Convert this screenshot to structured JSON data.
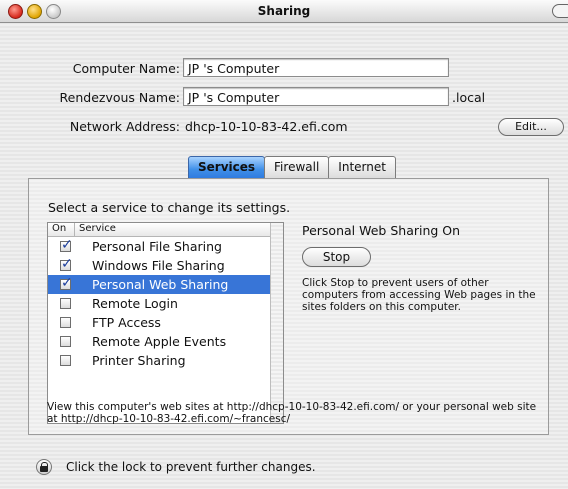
{
  "window": {
    "title": "Sharing"
  },
  "identity": {
    "computer_name_label": "Computer Name:",
    "computer_name_value": "JP 's Computer",
    "rendezvous_label": "Rendezvous Name:",
    "rendezvous_value": "JP 's Computer",
    "rendezvous_suffix": ".local",
    "network_label": "Network Address:",
    "network_value": "dhcp-10-10-83-42.efi.com",
    "edit_label": "Edit..."
  },
  "tabs": [
    {
      "label": "Services",
      "active": true
    },
    {
      "label": "Firewall",
      "active": false
    },
    {
      "label": "Internet",
      "active": false
    }
  ],
  "services": {
    "prompt": "Select a service to change its settings.",
    "col_on": "On",
    "col_service": "Service",
    "items": [
      {
        "name": "Personal File Sharing",
        "on": true,
        "selected": false
      },
      {
        "name": "Windows File Sharing",
        "on": true,
        "selected": false
      },
      {
        "name": "Personal Web Sharing",
        "on": true,
        "selected": true
      },
      {
        "name": "Remote Login",
        "on": false,
        "selected": false
      },
      {
        "name": "FTP Access",
        "on": false,
        "selected": false
      },
      {
        "name": "Remote Apple Events",
        "on": false,
        "selected": false
      },
      {
        "name": "Printer Sharing",
        "on": false,
        "selected": false
      }
    ],
    "status": "Personal Web Sharing On",
    "stop_label": "Stop",
    "explanation": "Click Stop to prevent users of other computers from accessing Web pages in the sites folders on this computer.",
    "footer": "View this computer's web sites at http://dhcp-10-10-83-42.efi.com/ or your personal web site at http://dhcp-10-10-83-42.efi.com/~francesc/"
  },
  "lock": {
    "text": "Click the lock to prevent further changes."
  },
  "colors": {
    "selection": "#3875d7",
    "active_tab": "#3f8fe8"
  }
}
